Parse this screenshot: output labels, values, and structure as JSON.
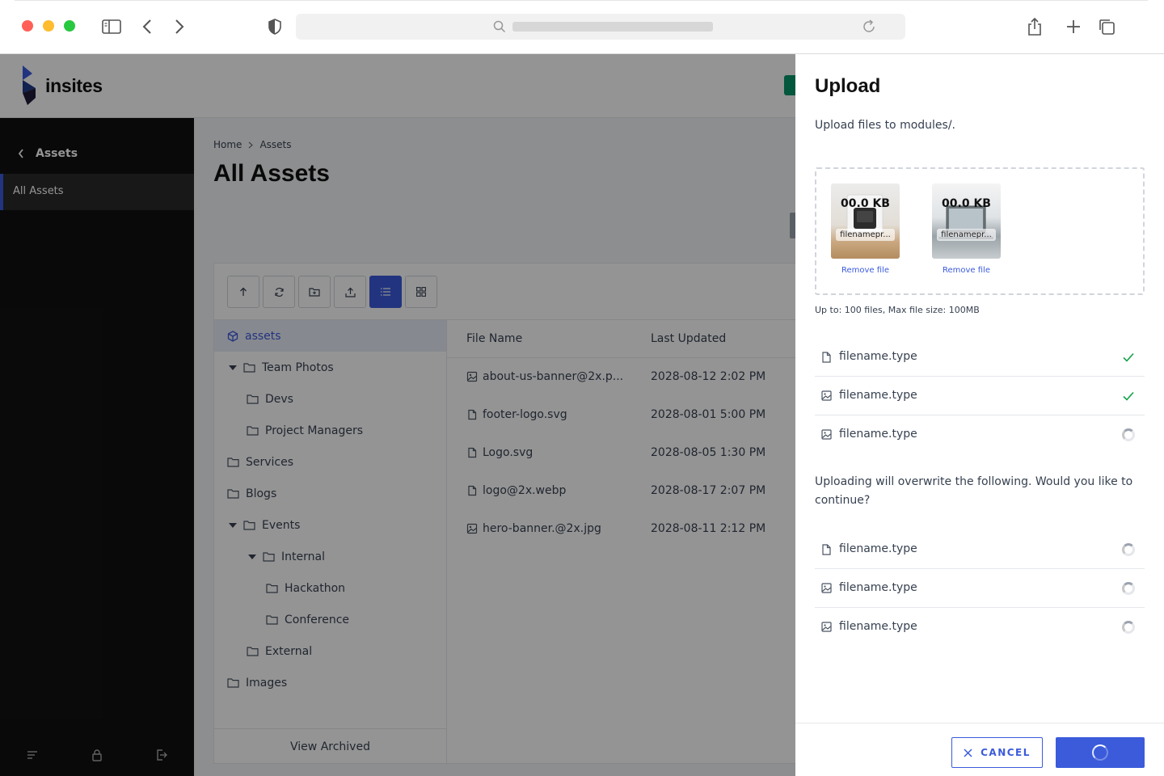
{
  "app": {
    "brand": "insites"
  },
  "sidebar": {
    "back_label": "Assets",
    "items": [
      {
        "label": "All Assets"
      }
    ]
  },
  "main": {
    "breadcrumb": [
      "Home",
      "Assets"
    ],
    "title": "All Assets",
    "tree": [
      {
        "label": "assets",
        "selected": true
      },
      {
        "label": "Team Photos",
        "expanded": true
      },
      {
        "label": "Devs"
      },
      {
        "label": "Project Managers"
      },
      {
        "label": "Services"
      },
      {
        "label": "Blogs"
      },
      {
        "label": "Events",
        "expanded": true
      },
      {
        "label": "Internal",
        "expanded": true
      },
      {
        "label": "Hackathon"
      },
      {
        "label": "Conference"
      },
      {
        "label": "External"
      },
      {
        "label": "Images"
      }
    ],
    "view_archived": "View Archived",
    "columns": {
      "name": "File Name",
      "updated": "Last Updated"
    },
    "files": [
      {
        "name": "about-us-banner@2x.p...",
        "updated": "2028-08-12 2:02 PM",
        "icon": "image-icon"
      },
      {
        "name": "footer-logo.svg",
        "updated": "2028-08-01 5:00 PM",
        "icon": "file-icon"
      },
      {
        "name": "Logo.svg",
        "updated": "2028-08-05 1:30 PM",
        "icon": "file-icon"
      },
      {
        "name": "logo@2x.webp",
        "updated": "2028-08-17 2:07 PM",
        "icon": "file-icon"
      },
      {
        "name": "hero-banner.@2x.jpg",
        "updated": "2028-08-11 2:12 PM",
        "icon": "image-icon"
      }
    ]
  },
  "drawer": {
    "title": "Upload",
    "subtitle": "Upload files to modules/.",
    "previews": [
      {
        "size": "00.0 KB",
        "filename": "filenamepr...",
        "remove": "Remove file"
      },
      {
        "size": "00.0 KB",
        "filename": "filenamepr...",
        "remove": "Remove file"
      }
    ],
    "limits": "Up to: 100 files, Max file size: 100MB",
    "uploads": [
      {
        "name": "filename.type",
        "icon": "file-icon",
        "status": "done"
      },
      {
        "name": "filename.type",
        "icon": "image-icon",
        "status": "done"
      },
      {
        "name": "filename.type",
        "icon": "image-icon",
        "status": "loading"
      }
    ],
    "overwrite_prompt": "Uploading will overwrite the following. Would you like to continue?",
    "overwrites": [
      {
        "name": "filename.type",
        "icon": "file-icon",
        "status": "loading"
      },
      {
        "name": "filename.type",
        "icon": "image-icon",
        "status": "loading"
      },
      {
        "name": "filename.type",
        "icon": "image-icon",
        "status": "loading"
      }
    ],
    "cancel_label": "CANCEL"
  },
  "colors": {
    "accent": "#3b5bdb",
    "success": "#16a34a",
    "sidebar": "#111111"
  }
}
